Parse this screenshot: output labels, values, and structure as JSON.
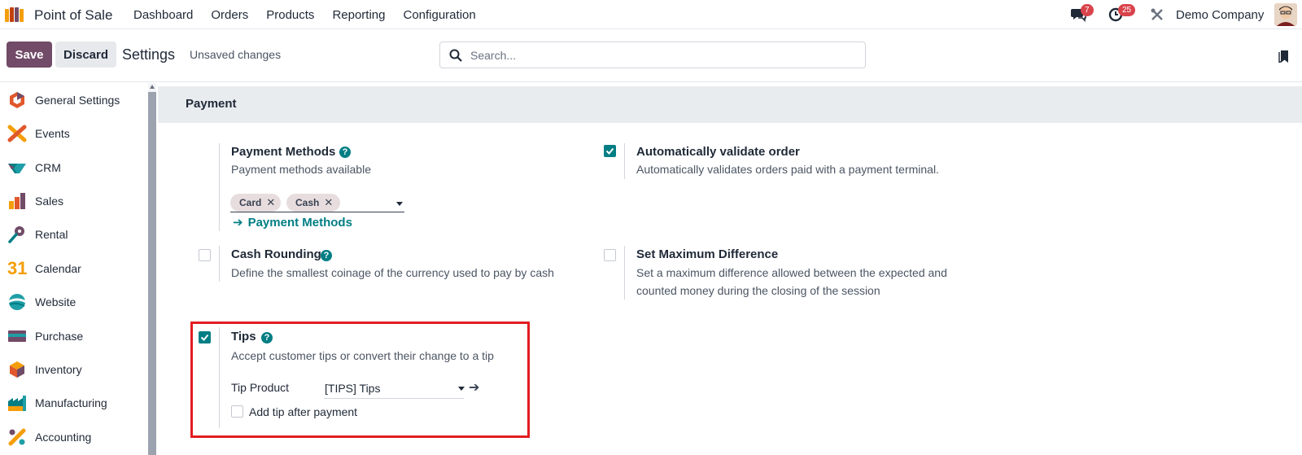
{
  "navbar": {
    "app_name": "Point of Sale",
    "menu": [
      "Dashboard",
      "Orders",
      "Products",
      "Reporting",
      "Configuration"
    ],
    "chat_badge": "7",
    "activity_badge": "25",
    "company": "Demo Company"
  },
  "control": {
    "save_label": "Save",
    "discard_label": "Discard",
    "title": "Settings",
    "status": "Unsaved changes",
    "search_placeholder": "Search..."
  },
  "sidebar": {
    "items": [
      {
        "label": "General Settings",
        "icon": "general-settings-icon"
      },
      {
        "label": "Events",
        "icon": "events-icon"
      },
      {
        "label": "CRM",
        "icon": "crm-icon"
      },
      {
        "label": "Sales",
        "icon": "sales-icon"
      },
      {
        "label": "Rental",
        "icon": "rental-icon"
      },
      {
        "label": "Calendar",
        "icon": "calendar-icon",
        "glyph": "31"
      },
      {
        "label": "Website",
        "icon": "website-icon"
      },
      {
        "label": "Purchase",
        "icon": "purchase-icon"
      },
      {
        "label": "Inventory",
        "icon": "inventory-icon"
      },
      {
        "label": "Manufacturing",
        "icon": "manufacturing-icon"
      },
      {
        "label": "Accounting",
        "icon": "accounting-icon"
      }
    ]
  },
  "section": {
    "title": "Payment"
  },
  "settings": {
    "payment_methods": {
      "title": "Payment Methods",
      "desc": "Payment methods available",
      "tags": [
        "Card",
        "Cash"
      ],
      "link": "Payment Methods"
    },
    "auto_validate": {
      "title": "Automatically validate order",
      "desc": "Automatically validates orders paid with a payment terminal.",
      "checked": true
    },
    "cash_rounding": {
      "title": "Cash Rounding",
      "desc": "Define the smallest coinage of the currency used to pay by cash",
      "checked": false
    },
    "max_difference": {
      "title": "Set Maximum Difference",
      "desc_line1": "Set a maximum difference allowed between the expected and",
      "desc_line2": "counted money during the closing of the session",
      "checked": false
    },
    "tips": {
      "title": "Tips",
      "desc": "Accept customer tips or convert their change to a tip",
      "checked": true,
      "tip_product_label": "Tip Product",
      "tip_product_value": "[TIPS] Tips",
      "add_tip_label": "Add tip after payment",
      "add_tip_checked": false
    }
  },
  "colors": {
    "brand": "#714b67",
    "accent": "#017e84",
    "badge": "#d9434b",
    "highlight": "#e11d22"
  }
}
